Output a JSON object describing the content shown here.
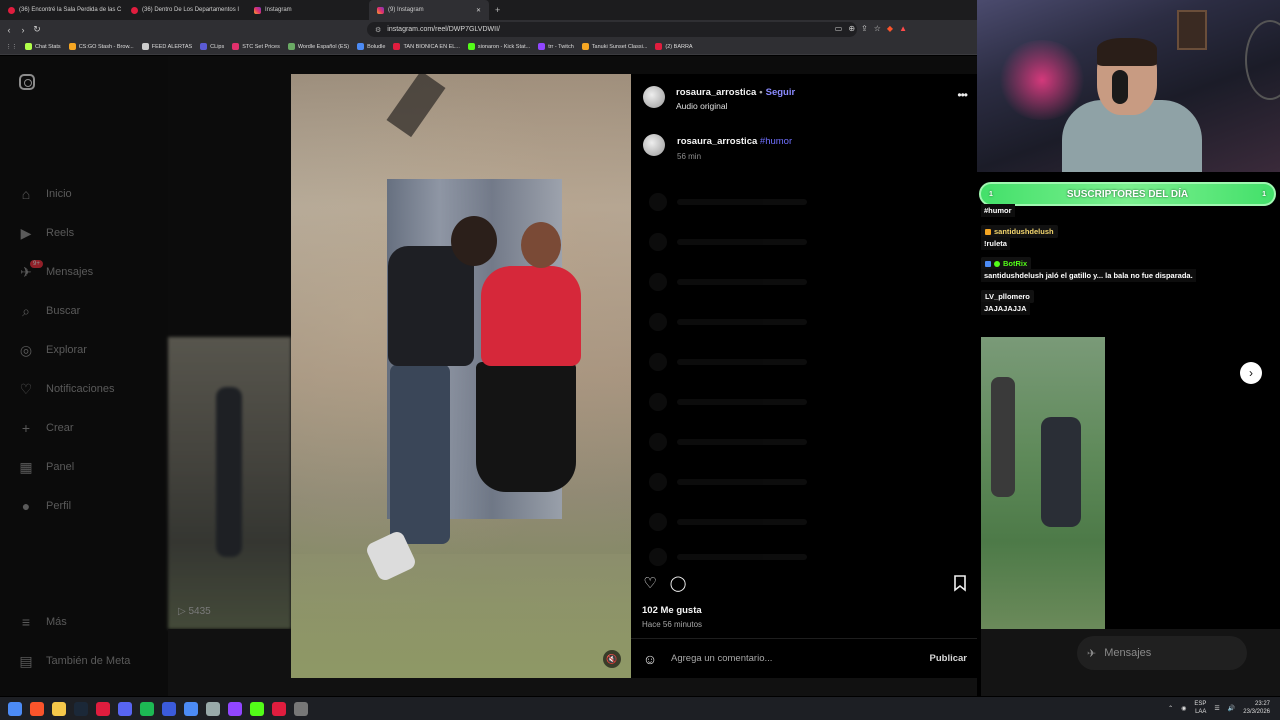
{
  "browser": {
    "tabs": [
      {
        "title": "(36) Encontré la Sala Perdida de las C",
        "active": false
      },
      {
        "title": "(36) Dentro De Los Departamentos I",
        "active": false
      },
      {
        "title": "Instagram",
        "active": false
      },
      {
        "title": "(9) Instagram",
        "active": true
      }
    ],
    "url": "instagram.com/reel/DWP7GLVDWII/",
    "bookmarks": [
      "Chat Stats",
      "CS:GO Stash - Brow...",
      "FEED ALERTAS",
      "CLips",
      "STC Set Prices",
      "Wordle Español (ES)",
      "Boludle",
      "TAN BIONICA EN EL...",
      "sionaron - Kick Stat...",
      "trr - Twitch",
      "Tanuki Sunset Classi...",
      "(2) BARRA"
    ]
  },
  "sidebar": {
    "items": [
      {
        "label": "Inicio",
        "icon": "home-icon"
      },
      {
        "label": "Reels",
        "icon": "reels-icon"
      },
      {
        "label": "Mensajes",
        "icon": "messages-icon",
        "badge": "9+"
      },
      {
        "label": "Buscar",
        "icon": "search-icon"
      },
      {
        "label": "Explorar",
        "icon": "explore-icon"
      },
      {
        "label": "Notificaciones",
        "icon": "heart-icon"
      },
      {
        "label": "Crear",
        "icon": "plus-icon"
      },
      {
        "label": "Panel",
        "icon": "dashboard-icon"
      },
      {
        "label": "Perfil",
        "icon": "profile-icon"
      }
    ],
    "bottom": [
      {
        "label": "Más",
        "icon": "menu-icon"
      },
      {
        "label": "También de Meta",
        "icon": "meta-icon"
      }
    ]
  },
  "background_views": "5435",
  "post": {
    "username": "rosaura_arrostica",
    "separator": "•",
    "follow_label": "Seguir",
    "audio": "Audio original",
    "more": "•••",
    "caption_user": "rosaura_arrostica",
    "caption_tag": "#humor",
    "caption_time": "56 min",
    "likes": "102 Me gusta",
    "posted_ago": "Hace 56 minutos",
    "comment_placeholder": "Agrega un comentario...",
    "publish_label": "Publicar"
  },
  "stream": {
    "subs_banner": "SUSCRIPTORES DEL DÍA",
    "subs_left": "1",
    "subs_right": "1",
    "chat": [
      {
        "user": "",
        "text": "#humor"
      },
      {
        "user": "santidushdelush",
        "text": "!ruleta"
      },
      {
        "user": "BotRix",
        "text": "santidushdelush jaló el gatillo y... la bala no fue disparada."
      },
      {
        "user": "LV_pllomero",
        "text": "JAJAJAJJA"
      }
    ],
    "messages_pill": "Mensajes",
    "messages_badge": "9+"
  },
  "taskbar": {
    "lang": "ESP",
    "lang2": "LAA",
    "time": "23:27",
    "date": "23/3/2026"
  },
  "colors": {
    "follow": "#8b8bff",
    "hashtag": "#7070ff",
    "subs_banner": "#43e06a",
    "badge": "#ff3040"
  }
}
